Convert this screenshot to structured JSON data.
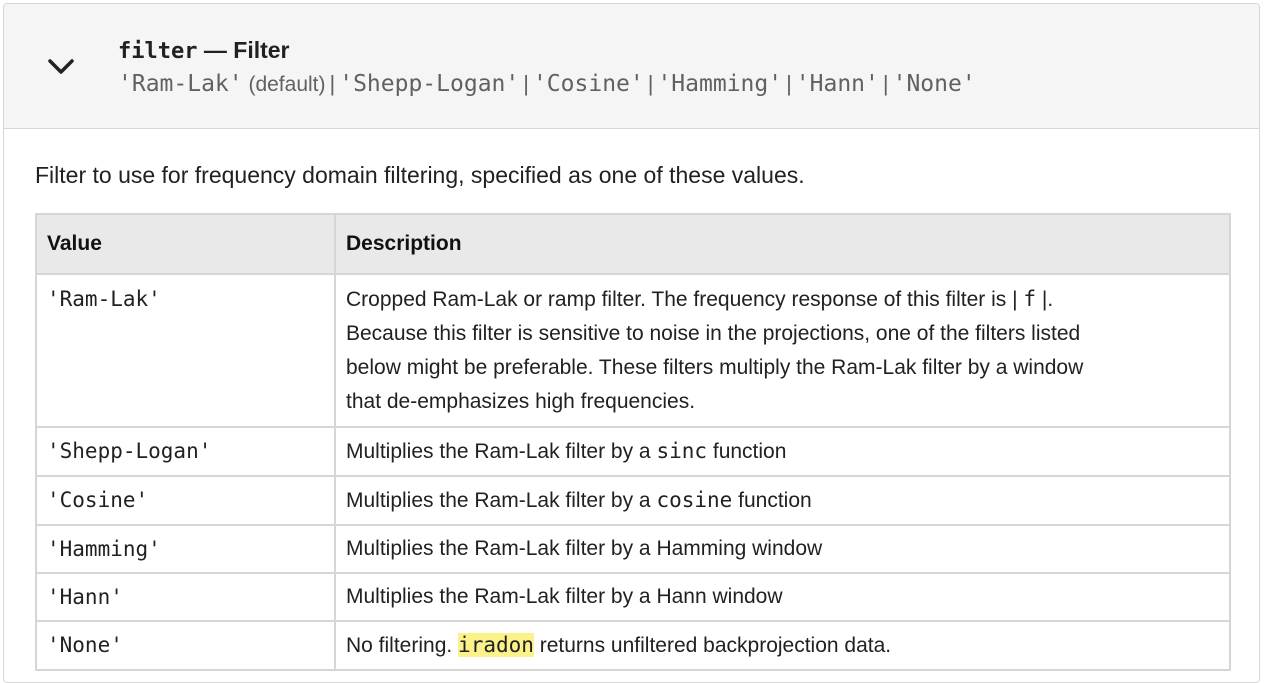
{
  "header": {
    "name": "filter",
    "dash": "—",
    "title": "Filter",
    "values": [
      {
        "code": "'Ram-Lak'",
        "note": "(default)"
      },
      {
        "code": "'Shepp-Logan'",
        "note": ""
      },
      {
        "code": "'Cosine'",
        "note": ""
      },
      {
        "code": "'Hamming'",
        "note": ""
      },
      {
        "code": "'Hann'",
        "note": ""
      },
      {
        "code": "'None'",
        "note": ""
      }
    ],
    "separator": "|",
    "expand_icon": "chevron-down-icon"
  },
  "intro": "Filter to use for frequency domain filtering, specified as one of these values.",
  "table": {
    "col_value": "Value",
    "col_description": "Description",
    "rows": [
      {
        "value": "'Ram-Lak'",
        "desc_before": "Cropped Ram-Lak or ramp filter. The frequency response of this filter is | ",
        "desc_code": "f",
        "desc_after": " |.",
        "desc_lines": [
          "Because this filter is sensitive to noise in the projections, one of the filters listed",
          "below might be preferable. These filters multiply the Ram-Lak filter by a window",
          "that de-emphasizes high frequencies."
        ]
      },
      {
        "value": "'Shepp-Logan'",
        "desc_before": "Multiplies the Ram-Lak filter by a ",
        "desc_code": "sinc",
        "desc_after": " function"
      },
      {
        "value": "'Cosine'",
        "desc_before": "Multiplies the Ram-Lak filter by a ",
        "desc_code": "cosine",
        "desc_after": " function"
      },
      {
        "value": "'Hamming'",
        "desc_before": "Multiplies the Ram-Lak filter by a Hamming window",
        "desc_code": "",
        "desc_after": ""
      },
      {
        "value": "'Hann'",
        "desc_before": "Multiplies the Ram-Lak filter by a Hann window",
        "desc_code": "",
        "desc_after": ""
      },
      {
        "value": "'None'",
        "desc_before": "No filtering. ",
        "desc_code": "iradon",
        "desc_after": " returns unfiltered backprojection data."
      }
    ]
  },
  "colors": {
    "highlight": "#fbf38a",
    "header_bg": "#f5f5f5",
    "table_header_bg": "#e9e9e9",
    "border": "#d6d6d6"
  }
}
